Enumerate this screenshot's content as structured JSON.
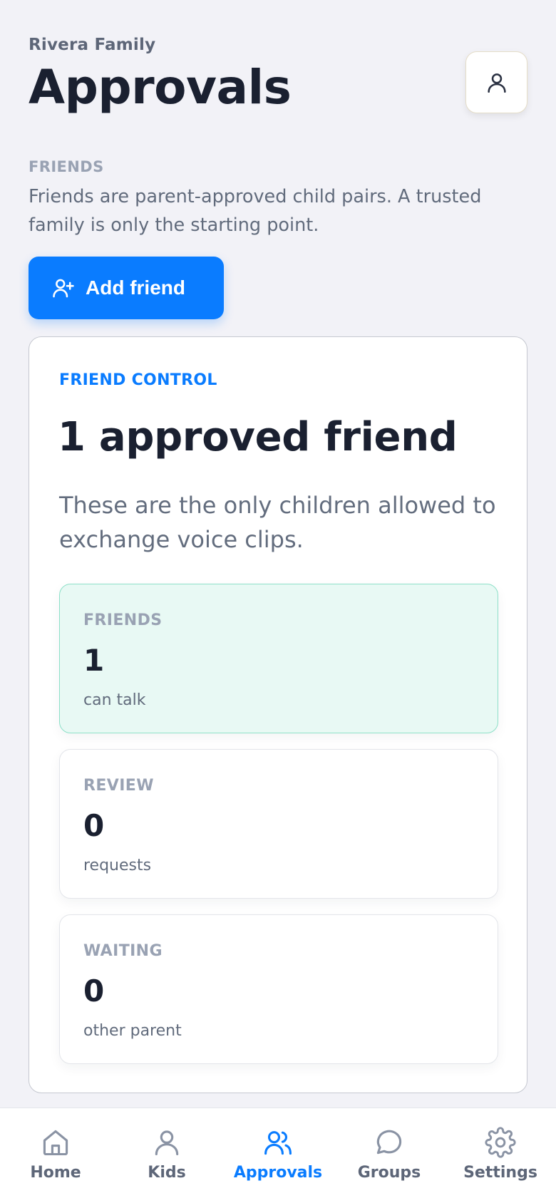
{
  "header": {
    "family_name": "Rivera Family",
    "title": "Approvals",
    "profile_icon": "person-icon"
  },
  "section": {
    "kicker": "FRIENDS",
    "description": "Friends are parent-approved child pairs. A trusted family is only the starting point."
  },
  "add_friend": {
    "label": "Add friend",
    "icon": "person-plus-icon"
  },
  "card": {
    "kicker": "FRIEND CONTROL",
    "title": "1 approved friend",
    "description": "These are the only children allowed to exchange voice clips.",
    "stats": [
      {
        "label": "FRIENDS",
        "value": "1",
        "sub": "can talk"
      },
      {
        "label": "REVIEW",
        "value": "0",
        "sub": "requests"
      },
      {
        "label": "WAITING",
        "value": "0",
        "sub": "other parent"
      }
    ]
  },
  "tabbar": {
    "items": [
      {
        "label": "Home",
        "icon": "home-icon"
      },
      {
        "label": "Kids",
        "icon": "person-icon"
      },
      {
        "label": "Approvals",
        "icon": "people-icon"
      },
      {
        "label": "Groups",
        "icon": "chat-bubble-icon"
      },
      {
        "label": "Settings",
        "icon": "gear-icon"
      }
    ],
    "active": "Approvals"
  },
  "colors": {
    "accent": "#0a7cff",
    "background": "#f2f2f7",
    "active_stat_bg": "#e8f9f4",
    "active_stat_border": "#8de0c8"
  }
}
